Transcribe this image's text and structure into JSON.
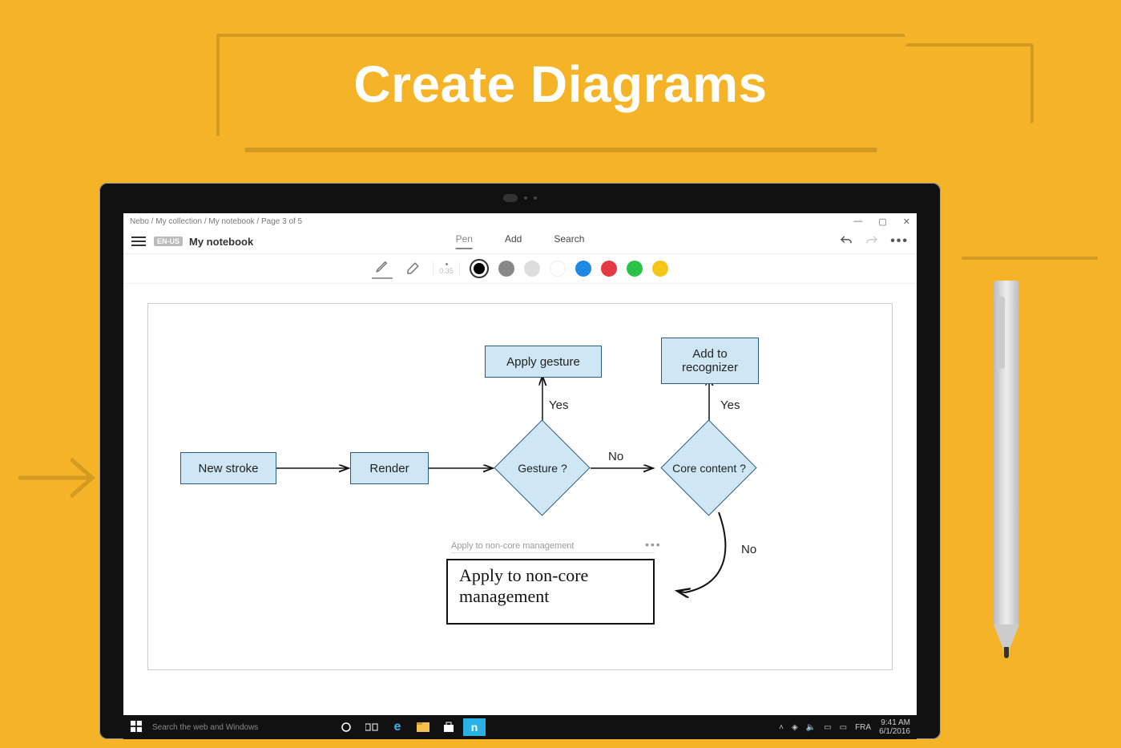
{
  "hero": {
    "title": "Create Diagrams"
  },
  "breadcrumb": "Nebo  /  My collection  /  My notebook /  Page 3 of 5",
  "window_controls": {
    "min": "—",
    "max": "▢",
    "close": "✕"
  },
  "header": {
    "lang_badge": "EN-US",
    "notebook_name": "My notebook",
    "tabs": [
      "Pen",
      "Add",
      "Search"
    ],
    "active_tab": 0,
    "more": "•••"
  },
  "toolbar": {
    "pen_size": "0.35",
    "colors": [
      "#000000",
      "#888888",
      "#dddddd",
      "#ffffff",
      "#1e88e5",
      "#e53945",
      "#2bc24a",
      "#f5c518"
    ],
    "selected_color_index": 0
  },
  "flowchart": {
    "nodes": {
      "new_stroke": "New stroke",
      "render": "Render",
      "gesture": "Gesture ?",
      "core": "Core content ?",
      "apply_gesture": "Apply gesture",
      "add_recognizer": "Add to\nrecognizer"
    },
    "edge_labels": {
      "yes1": "Yes",
      "yes2": "Yes",
      "no1": "No",
      "no2": "No"
    },
    "converted_text": "Apply to non-core management",
    "handwritten_text": "Apply to non-core\nmanagement"
  },
  "taskbar": {
    "search_placeholder": "Search the web and Windows",
    "tray_lang": "FRA",
    "time": "9:41 AM",
    "date": "6/1/2016"
  }
}
